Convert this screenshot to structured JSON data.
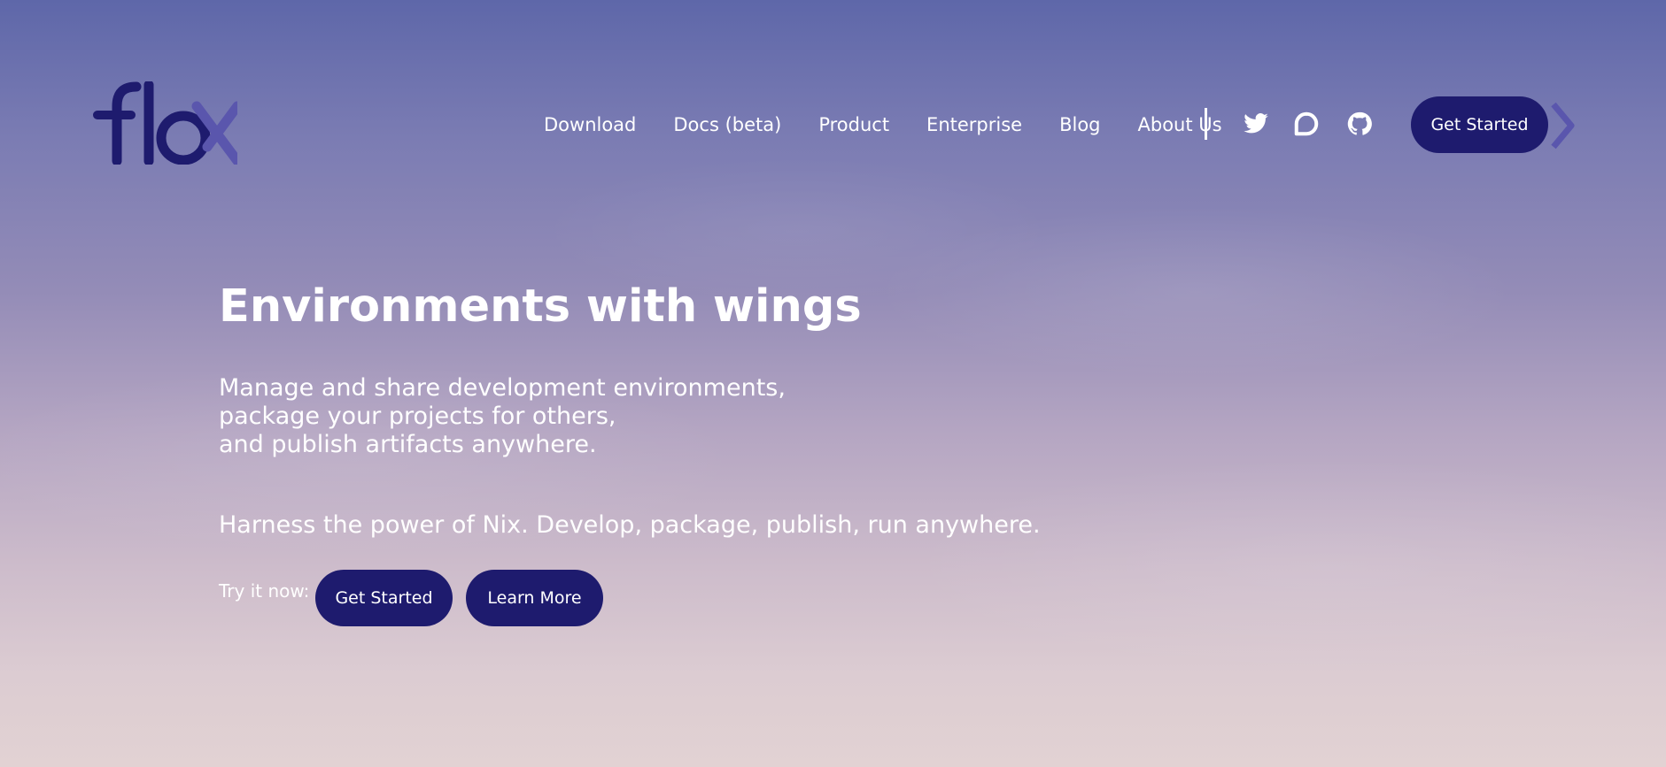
{
  "brand": {
    "name": "flox",
    "colors": {
      "primary": "#1e1b6e",
      "accent": "#5a56ad",
      "text": "#ffffff"
    }
  },
  "nav": {
    "links": [
      "Download",
      "Docs (beta)",
      "Product",
      "Enterprise",
      "Blog",
      "About Us"
    ],
    "social": [
      "twitter-icon",
      "discourse-icon",
      "github-icon"
    ],
    "cta_label": "Get Started"
  },
  "hero": {
    "title": "Environments with wings",
    "subtitle_lines": [
      "Manage and share development environments,",
      "package your projects for others,",
      "and publish artifacts anywhere."
    ],
    "tagline": "Harness the power of Nix. Develop, package, publish, run anywhere.",
    "try_label": "Try it now:",
    "primary_cta": "Get Started",
    "secondary_cta": "Learn More"
  }
}
